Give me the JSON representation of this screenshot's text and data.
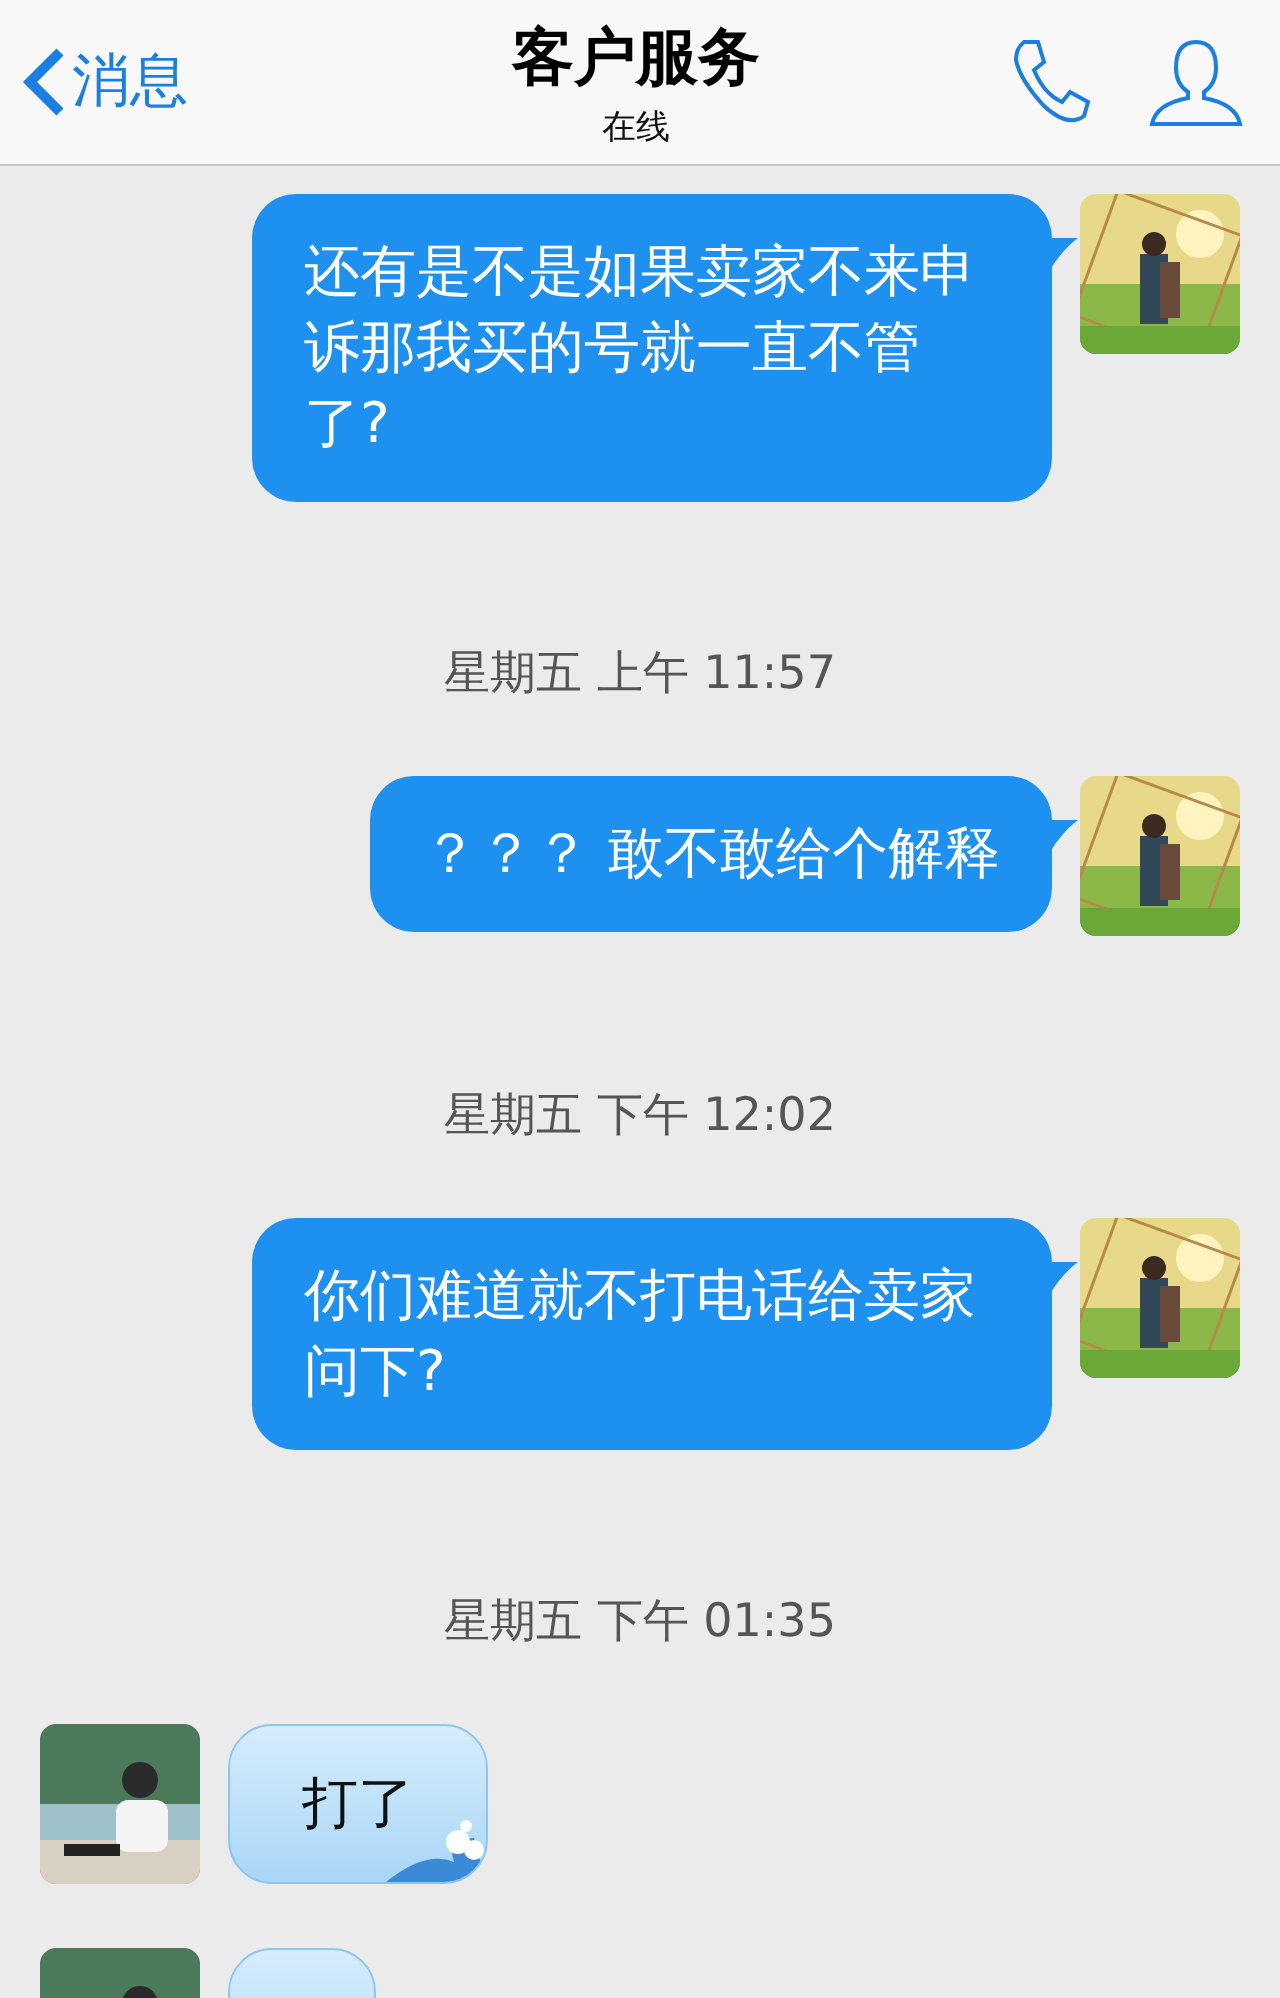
{
  "header": {
    "back": "消息",
    "title": "客户服务",
    "status": "在线"
  },
  "messages": [
    {
      "kind": "outgoing",
      "text": "还有是不是如果卖家不来申诉那我买的号就一直不管了?"
    },
    {
      "kind": "time",
      "text": "星期五 上午 11:57"
    },
    {
      "kind": "outgoing",
      "text": "？？？ 敢不敢给个解释"
    },
    {
      "kind": "time",
      "text": "星期五 下午 12:02"
    },
    {
      "kind": "outgoing",
      "text": "你们难道就不打电话给卖家问下?"
    },
    {
      "kind": "time",
      "text": "星期五 下午 01:35"
    },
    {
      "kind": "incoming",
      "text": "打了"
    },
    {
      "kind": "incoming"
    }
  ]
}
